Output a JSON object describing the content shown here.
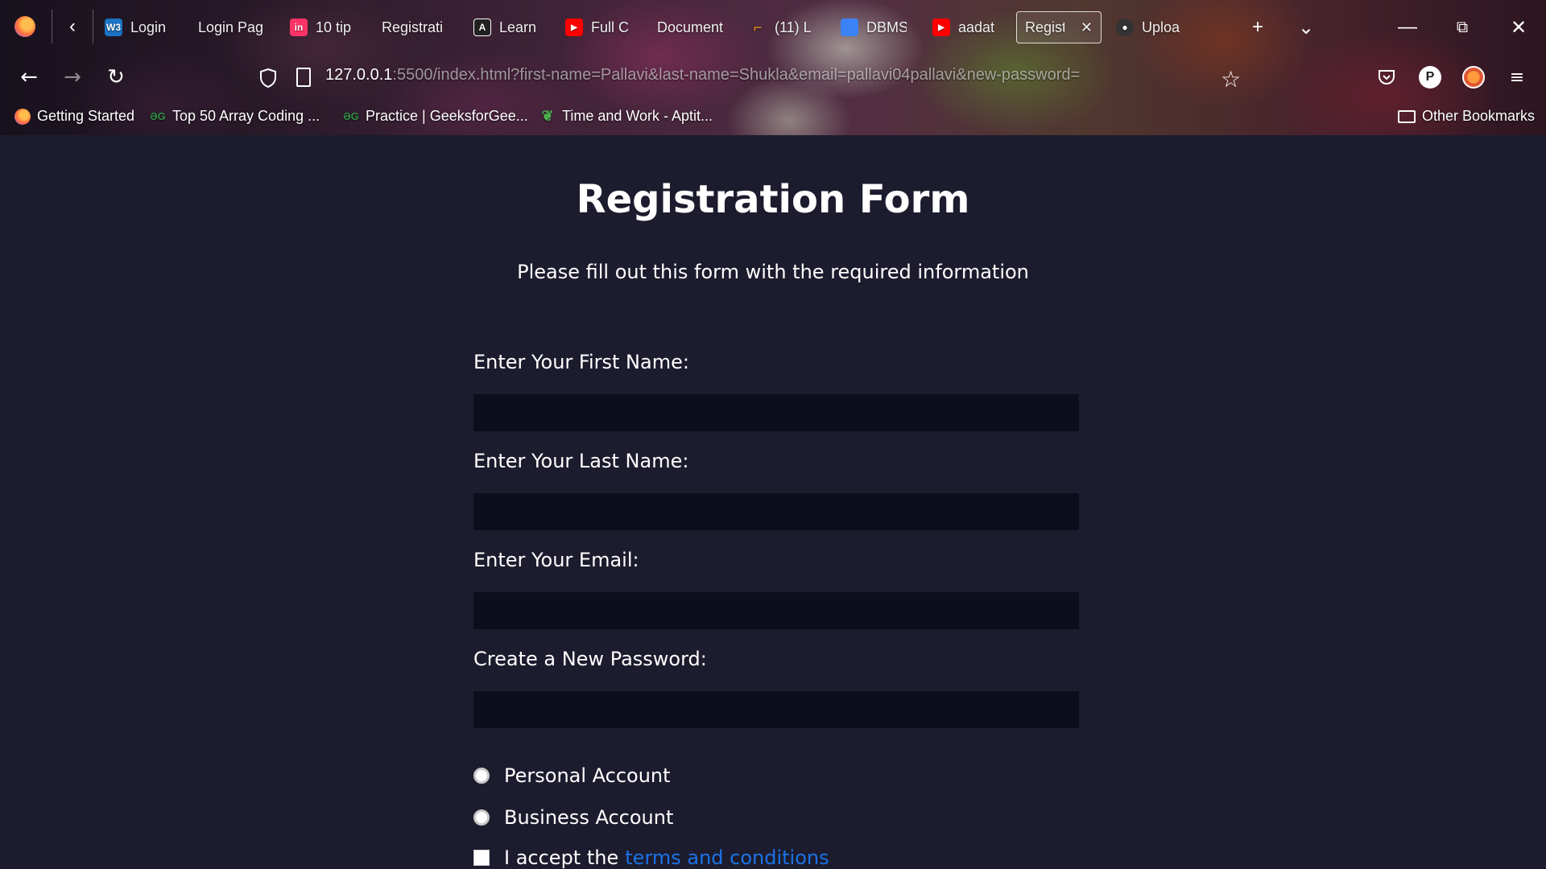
{
  "browser": {
    "tabs": [
      {
        "label": "Login",
        "icon": "w3schools-icon",
        "icon_text": "W3",
        "icon_color": "#1a73c4"
      },
      {
        "label": "Login Pag",
        "icon": "none-icon",
        "icon_text": "",
        "icon_color": ""
      },
      {
        "label": "10 tip",
        "icon": "invision-icon",
        "icon_text": "in",
        "icon_color": "#ff3366"
      },
      {
        "label": "Registrati",
        "icon": "none-icon",
        "icon_text": "",
        "icon_color": ""
      },
      {
        "label": "Learn",
        "icon": "angular-icon",
        "icon_text": "A",
        "icon_color": "#222222"
      },
      {
        "label": "Full C",
        "icon": "youtube-icon",
        "icon_text": "▶",
        "icon_color": "#ff0000"
      },
      {
        "label": "Document",
        "icon": "none-icon",
        "icon_text": "",
        "icon_color": ""
      },
      {
        "label": "(11) L",
        "icon": "leetcode-icon",
        "icon_text": "⌐",
        "icon_color": "#f89f1b"
      },
      {
        "label": "DBMS",
        "icon": "contacts-icon",
        "icon_text": "👤",
        "icon_color": "#3b82f6"
      },
      {
        "label": "aadat",
        "icon": "youtube-icon",
        "icon_text": "▶",
        "icon_color": "#ff0000"
      },
      {
        "label": "Regist",
        "icon": "none-icon",
        "icon_text": "",
        "icon_color": "",
        "active": true,
        "close": "✕"
      },
      {
        "label": "Uploa",
        "icon": "github-icon",
        "icon_text": "●",
        "icon_color": "#333333"
      }
    ],
    "new_tab": "+",
    "tab_list": "⌄",
    "window_controls": {
      "minimize": "—",
      "restore": "⧉",
      "close": "✕"
    },
    "nav": {
      "back": "←",
      "forward": "→",
      "reload": "↻"
    },
    "url_host": "127.0.0.1",
    "url_rest": ":5500/index.html?first-name=Pallavi&last-name=Shukla&email=pallavi04pallavi&new-password=",
    "star": "☆",
    "profile_initial": "P",
    "menu": "≡",
    "bookmarks": [
      {
        "label": "Getting Started",
        "icon": "firefox-icon",
        "icon_text": "",
        "icon_color": "#ff7139"
      },
      {
        "label": "Top 50 Array Coding ...",
        "icon": "geeksforgeeks-icon",
        "icon_text": "ƏG",
        "icon_color": "#2f8d46"
      },
      {
        "label": "Practice | GeeksforGee...",
        "icon": "geeksforgeeks-icon",
        "icon_text": "ƏG",
        "icon_color": "#2f8d46"
      },
      {
        "label": "Time and Work - Aptit...",
        "icon": "leaf-icon",
        "icon_text": "❦",
        "icon_color": "#4caf50"
      }
    ],
    "other_bookmarks": "Other Bookmarks"
  },
  "page": {
    "title": "Registration Form",
    "subtitle": "Please fill out this form with the required information",
    "fields": [
      {
        "label": "Enter Your First Name:",
        "value": ""
      },
      {
        "label": "Enter Your Last Name:",
        "value": ""
      },
      {
        "label": "Enter Your Email:",
        "value": ""
      },
      {
        "label": "Create a New Password:",
        "value": ""
      }
    ],
    "account_options": [
      "Personal Account",
      "Business Account"
    ],
    "terms_prefix": "I accept the",
    "terms_link": "terms and conditions"
  }
}
